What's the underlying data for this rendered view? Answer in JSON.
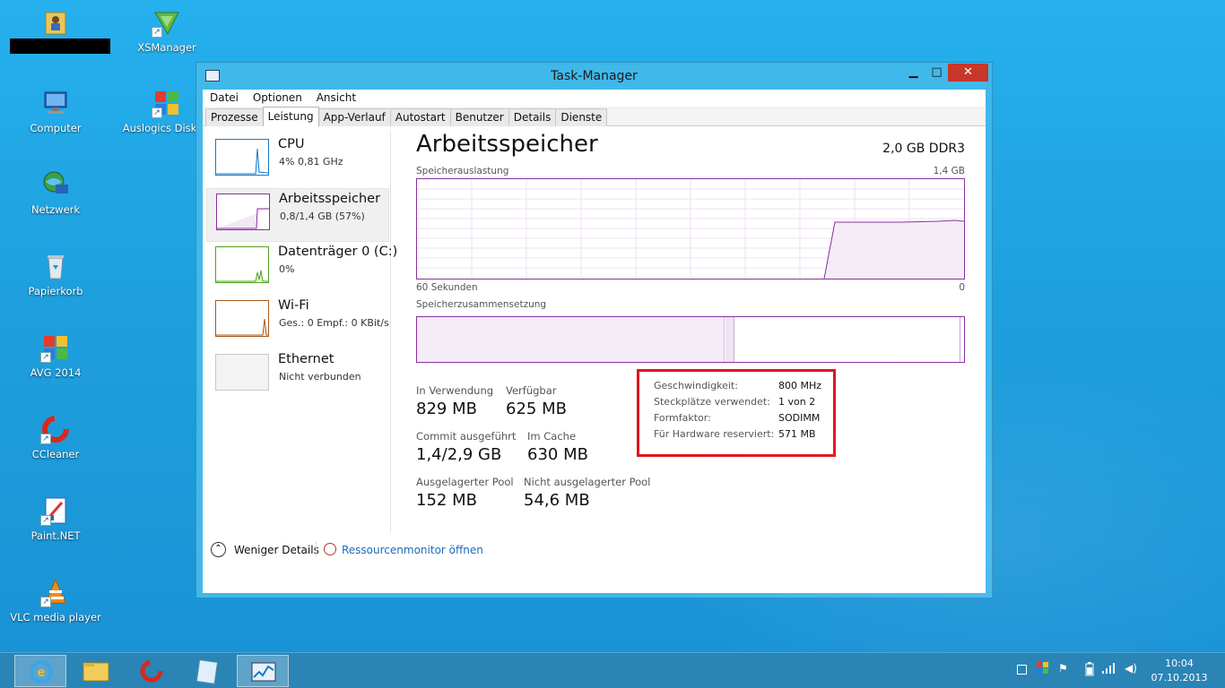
{
  "desktop": {
    "icons": [
      {
        "label": "",
        "icon": "user-folder-icon"
      },
      {
        "label": "XSManager",
        "icon": "xsmanager-icon"
      },
      {
        "label": "Computer",
        "icon": "computer-icon"
      },
      {
        "label": "Auslogics DiskDe",
        "icon": "auslogics-icon"
      },
      {
        "label": "Netzwerk",
        "icon": "network-icon"
      },
      {
        "label": "Papierkorb",
        "icon": "recycle-bin-icon"
      },
      {
        "label": "AVG 2014",
        "icon": "avg-icon"
      },
      {
        "label": "CCleaner",
        "icon": "ccleaner-icon"
      },
      {
        "label": "Paint.NET",
        "icon": "paintnet-icon"
      },
      {
        "label": "VLC media player",
        "icon": "vlc-icon"
      }
    ]
  },
  "window": {
    "title": "Task-Manager",
    "controls": {
      "minimize": "▁",
      "maximize": "□",
      "close": "✕"
    },
    "menu": [
      "Datei",
      "Optionen",
      "Ansicht"
    ],
    "tabs": [
      "Prozesse",
      "Leistung",
      "App-Verlauf",
      "Autostart",
      "Benutzer",
      "Details",
      "Dienste"
    ],
    "active_tab": "Leistung"
  },
  "panel": {
    "items": [
      {
        "name": "CPU",
        "sub": "4% 0,81 GHz",
        "color": "#1a79c6"
      },
      {
        "name": "Arbeitsspeicher",
        "sub": "0,8/1,4 GB (57%)",
        "color": "#8b2fa0"
      },
      {
        "name": "Datenträger 0 (C:)",
        "sub": "0%",
        "color": "#4da31a"
      },
      {
        "name": "Wi-Fi",
        "sub": "Ges.: 0 Empf.: 0 KBit/s",
        "color": "#a7591b"
      },
      {
        "name": "Ethernet",
        "sub": "Nicht verbunden",
        "color": "#b0b0b0"
      }
    ]
  },
  "memory": {
    "heading": "Arbeitsspeicher",
    "spec": "2,0 GB DDR3",
    "usage_label": "Speicherauslastung",
    "usage_max": "1,4 GB",
    "axis_left": "60 Sekunden",
    "axis_right": "0",
    "composition_label": "Speicherzusammensetzung",
    "stats": {
      "in_use_label": "In Verwendung",
      "in_use": "829 MB",
      "available_label": "Verfügbar",
      "available": "625 MB",
      "commit_label": "Commit ausgeführt",
      "commit": "1,4/2,9 GB",
      "cache_label": "Im Cache",
      "cache": "630 MB",
      "paged_label": "Ausgelagerter Pool",
      "paged": "152 MB",
      "nonpaged_label": "Nicht ausgelagerter Pool",
      "nonpaged": "54,6 MB"
    },
    "hardware": [
      {
        "key": "Geschwindigkeit:",
        "value": "800 MHz"
      },
      {
        "key": "Steckplätze verwendet:",
        "value": "1 von 2"
      },
      {
        "key": "Formfaktor:",
        "value": "SODIMM"
      },
      {
        "key": "Für Hardware reserviert:",
        "value": "571 MB"
      }
    ]
  },
  "footer": {
    "fewer_details": "Weniger Details",
    "resource_monitor": "Ressourcenmonitor öffnen"
  },
  "taskbar": {
    "apps": [
      "ie-icon",
      "explorer-icon",
      "ccleaner-icon",
      "notepad-icon",
      "taskmanager-icon"
    ],
    "time": "10:04",
    "date": "07.10.2013"
  }
}
